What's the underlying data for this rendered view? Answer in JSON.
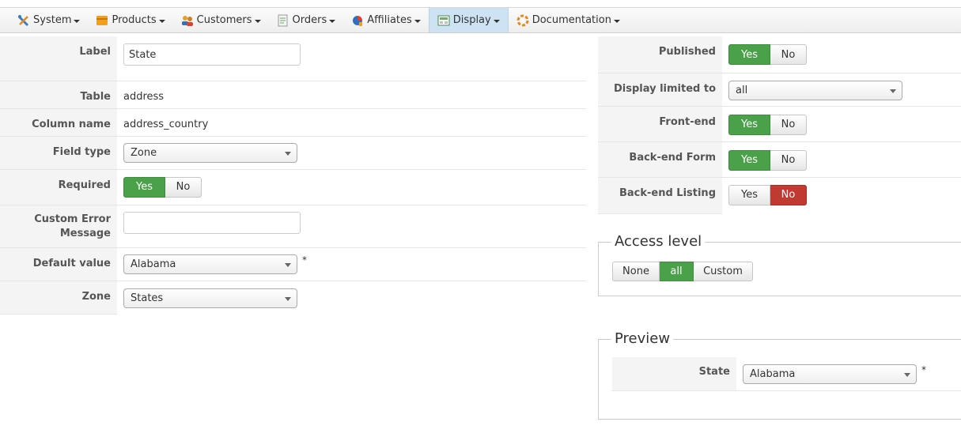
{
  "menu": [
    {
      "label": "System",
      "icon": "tools-icon",
      "active": false
    },
    {
      "label": "Products",
      "icon": "box-icon",
      "active": false
    },
    {
      "label": "Customers",
      "icon": "users-icon",
      "active": false
    },
    {
      "label": "Orders",
      "icon": "orders-icon",
      "active": false
    },
    {
      "label": "Affiliates",
      "icon": "chart-icon",
      "active": false
    },
    {
      "label": "Display",
      "icon": "display-icon",
      "active": true
    },
    {
      "label": "Documentation",
      "icon": "help-icon",
      "active": false
    }
  ],
  "form": {
    "label": {
      "label": "Label",
      "value": "State"
    },
    "table": {
      "label": "Table",
      "value": "address"
    },
    "column": {
      "label": "Column name",
      "value": "address_country"
    },
    "field_type": {
      "label": "Field type",
      "value": "Zone"
    },
    "required": {
      "label": "Required",
      "yes": "Yes",
      "no": "No",
      "selected": "Yes"
    },
    "custom_error": {
      "label_line1": "Custom Error",
      "label_line2": "Message",
      "value": ""
    },
    "default_value": {
      "label": "Default value",
      "value": "Alabama",
      "star": "*"
    },
    "zone": {
      "label": "Zone",
      "value": "States"
    }
  },
  "settings": {
    "published": {
      "label": "Published",
      "yes": "Yes",
      "no": "No",
      "selected": "Yes"
    },
    "display_limited": {
      "label": "Display limited to",
      "value": "all"
    },
    "frontend": {
      "label": "Front-end",
      "yes": "Yes",
      "no": "No",
      "selected": "Yes"
    },
    "backend_form": {
      "label": "Back-end Form",
      "yes": "Yes",
      "no": "No",
      "selected": "Yes"
    },
    "backend_listing": {
      "label": "Back-end Listing",
      "yes": "Yes",
      "no": "No",
      "selected": "No"
    }
  },
  "access": {
    "legend": "Access level",
    "options": [
      "None",
      "all",
      "Custom"
    ],
    "selected": "all"
  },
  "preview": {
    "legend": "Preview",
    "label": "State",
    "value": "Alabama",
    "star": "*"
  },
  "colors": {
    "accent_green": "#4aa14a",
    "accent_red": "#c13a31",
    "menu_active": "#cde3f3"
  }
}
